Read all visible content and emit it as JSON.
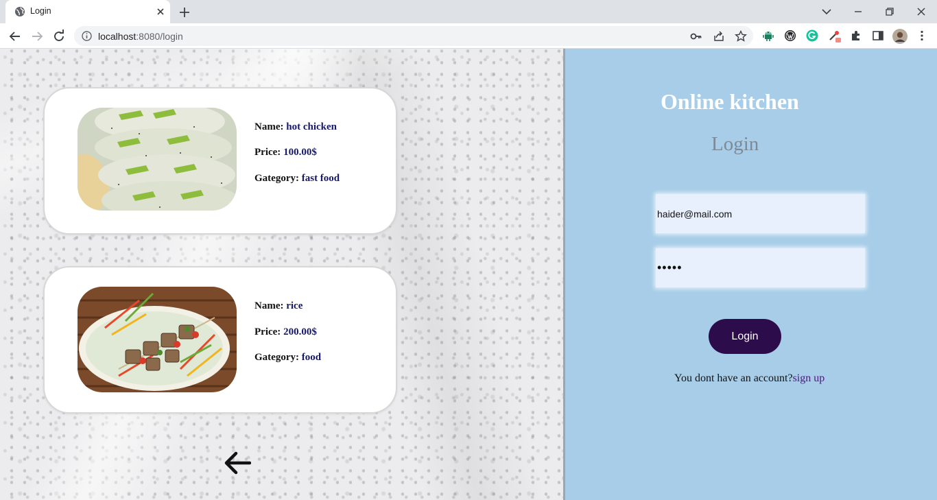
{
  "browser": {
    "tab_title": "Login",
    "url_host": "localhost",
    "url_rest": ":8080/login"
  },
  "foods": [
    {
      "name_label": "Name:",
      "name": "hot chicken",
      "price_label": "Price:",
      "price": "100.00$",
      "category_label": "Gategory:",
      "category": "fast food",
      "photo": "sushi-rolls-photo"
    },
    {
      "name_label": "Name:",
      "name": "rice",
      "price_label": "Price:",
      "price": "200.00$",
      "category_label": "Gategory:",
      "category": "food",
      "photo": "kebab-plate-photo"
    }
  ],
  "login": {
    "brand": "Online kitchen",
    "heading": "Login",
    "email_value": "haider@mail.com",
    "password_value": "•••••",
    "button_label": "Login",
    "signup_prompt": "You dont have an account?",
    "signup_link": "sign up"
  },
  "colors": {
    "right_pane": "#a7cde8",
    "button": "#2c0c4a",
    "value_text": "#15186b",
    "input_bg": "#e8f0fe"
  }
}
